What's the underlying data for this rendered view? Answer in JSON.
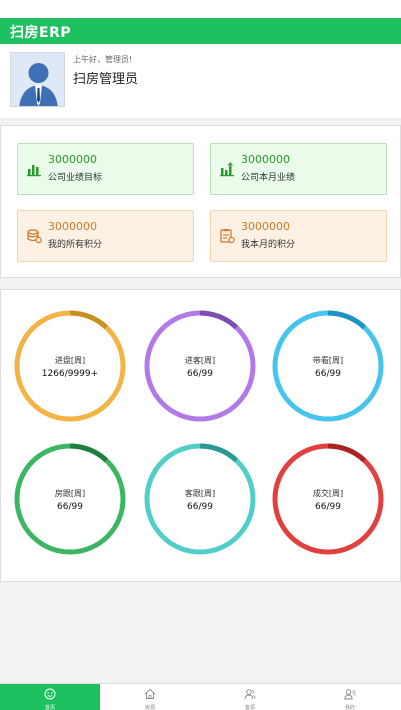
{
  "app": {
    "title": "扫房ERP"
  },
  "profile": {
    "greeting": "上午好，管理员!",
    "name": "扫房管理员"
  },
  "stats": [
    {
      "value": "3000000",
      "label": "公司业绩目标",
      "icon": "bar-chart-icon",
      "tone": "green"
    },
    {
      "value": "3000000",
      "label": "公司本月业绩",
      "icon": "trend-chart-icon",
      "tone": "green"
    },
    {
      "value": "3000000",
      "label": "我的所有积分",
      "icon": "coins-icon",
      "tone": "orange"
    },
    {
      "value": "3000000",
      "label": "我本月的积分",
      "icon": "points-icon",
      "tone": "orange"
    }
  ],
  "rings": [
    {
      "label": "进盘[周]",
      "value": "1266/9999+",
      "color": "#f3b445",
      "accent": "#c98f23",
      "progress": 0.1266
    },
    {
      "label": "进客[周]",
      "value": "66/99",
      "color": "#b27ae8",
      "accent": "#7b4fb0",
      "progress": 0.6667
    },
    {
      "label": "带看[周]",
      "value": "66/99",
      "color": "#45c4ee",
      "accent": "#1f93c2",
      "progress": 0.6667
    },
    {
      "label": "房跟[周]",
      "value": "66/99",
      "color": "#3cb662",
      "accent": "#1f7e3e",
      "progress": 0.6667
    },
    {
      "label": "客跟[周]",
      "value": "66/99",
      "color": "#50cec8",
      "accent": "#2a9994",
      "progress": 0.6667
    },
    {
      "label": "成交[周]",
      "value": "66/99",
      "color": "#e24040",
      "accent": "#a82424",
      "progress": 0.6667
    }
  ],
  "tabs": [
    {
      "label": "首页",
      "icon": "home-face-icon",
      "active": true
    },
    {
      "label": "房源",
      "icon": "house-icon",
      "active": false
    },
    {
      "label": "客源",
      "icon": "users-icon",
      "active": false
    },
    {
      "label": "我的",
      "icon": "profile-icon",
      "active": false
    }
  ],
  "colors": {
    "brand": "#1ec160"
  }
}
